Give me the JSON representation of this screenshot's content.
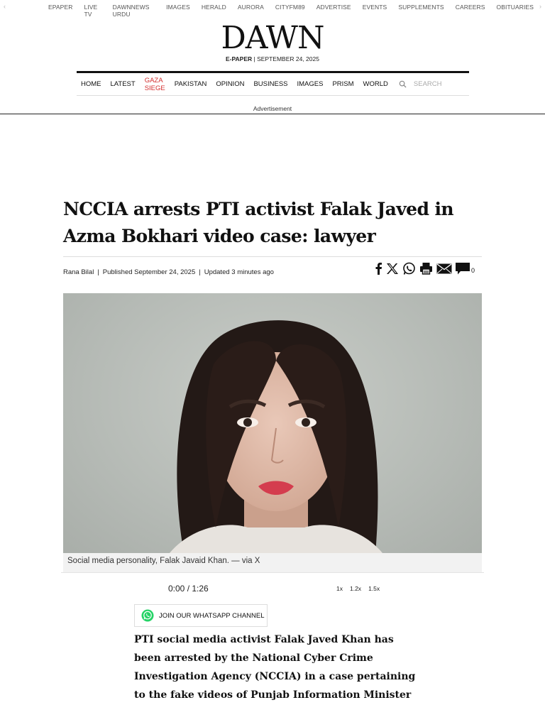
{
  "topbar": {
    "items": [
      "EPAPER",
      "LIVE TV",
      "DAWNNEWS URDU",
      "IMAGES",
      "HERALD",
      "AURORA",
      "CITYFM89",
      "ADVERTISE",
      "EVENTS",
      "SUPPLEMENTS",
      "CAREERS",
      "OBITUARIES"
    ],
    "arrow_left": "‹",
    "arrow_right": "›"
  },
  "masthead": {
    "logo": "DAWN",
    "edition_label": "E-PAPER",
    "edition_sep": " | ",
    "date": "SEPTEMBER 24, 2025"
  },
  "nav": {
    "items": [
      "HOME",
      "LATEST",
      "GAZA SIEGE",
      "PAKISTAN",
      "OPINION",
      "BUSINESS",
      "IMAGES",
      "PRISM",
      "WORLD"
    ],
    "search_placeholder": "SEARCH",
    "highlight_color": "#d32f2f"
  },
  "ad": {
    "label": "Advertisement"
  },
  "article": {
    "headline": "NCCIA arrests PTI activist Falak Javed in Azma Bokhari video case: lawyer",
    "author": "Rana Bilal",
    "published": "Published September 24, 2025",
    "updated": "Updated 3 minutes ago",
    "byline_sep": "|",
    "comment_count": "0",
    "caption": "Social media personality, Falak Javaid Khan. — via X",
    "audio_time": "0:00 / 1:26",
    "speeds": [
      "1x",
      "1.2x",
      "1.5x"
    ],
    "whatsapp_label": "JOIN OUR WHATSAPP CHANNEL",
    "body": "PTI social media activist Falak Javed Khan has been arrested by the National Cyber Crime Investigation Agency (NCCIA) in a case pertaining to the fake videos of Punjab Information Minister"
  },
  "share_icons": [
    "facebook-icon",
    "x-icon",
    "whatsapp-icon",
    "print-icon",
    "email-icon",
    "comment-icon"
  ]
}
